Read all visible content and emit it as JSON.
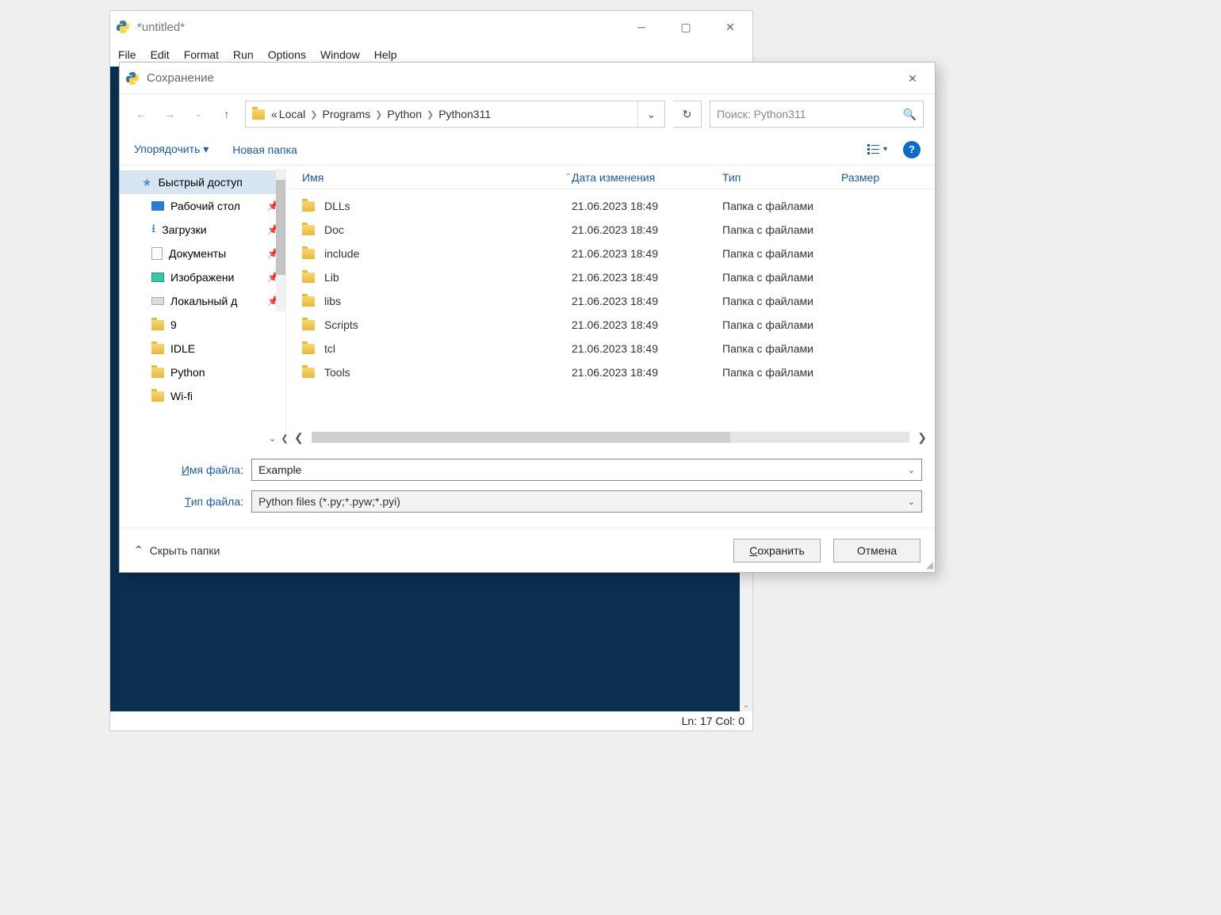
{
  "idle": {
    "title": "*untitled*",
    "menu": [
      "File",
      "Edit",
      "Format",
      "Run",
      "Options",
      "Window",
      "Help"
    ],
    "status": "Ln: 17  Col: 0"
  },
  "dialog": {
    "title": "Сохранение",
    "breadcrumb": {
      "prefix": "«",
      "parts": [
        "Local",
        "Programs",
        "Python",
        "Python311"
      ]
    },
    "search_placeholder": "Поиск: Python311",
    "toolbar": {
      "organize": "Упорядочить",
      "new_folder": "Новая папка"
    },
    "sidebar": [
      {
        "label": "Быстрый доступ",
        "icon": "star",
        "selected": true
      },
      {
        "label": "Рабочий стол",
        "icon": "desktop",
        "pin": true,
        "level": 2
      },
      {
        "label": "Загрузки",
        "icon": "download",
        "pin": true,
        "level": 2
      },
      {
        "label": "Документы",
        "icon": "doc",
        "pin": true,
        "level": 2
      },
      {
        "label": "Изображени",
        "icon": "img",
        "pin": true,
        "level": 2
      },
      {
        "label": "Локальный д",
        "icon": "disk",
        "pin": true,
        "level": 2
      },
      {
        "label": "9",
        "icon": "folder",
        "level": 2
      },
      {
        "label": "IDLE",
        "icon": "folder",
        "level": 2
      },
      {
        "label": "Python",
        "icon": "folder",
        "level": 2
      },
      {
        "label": "Wi-fi",
        "icon": "folder",
        "level": 2
      }
    ],
    "columns": {
      "name": "Имя",
      "date": "Дата изменения",
      "type": "Тип",
      "size": "Размер"
    },
    "files": [
      {
        "name": "DLLs",
        "date": "21.06.2023 18:49",
        "type": "Папка с файлами"
      },
      {
        "name": "Doc",
        "date": "21.06.2023 18:49",
        "type": "Папка с файлами"
      },
      {
        "name": "include",
        "date": "21.06.2023 18:49",
        "type": "Папка с файлами"
      },
      {
        "name": "Lib",
        "date": "21.06.2023 18:49",
        "type": "Папка с файлами"
      },
      {
        "name": "libs",
        "date": "21.06.2023 18:49",
        "type": "Папка с файлами"
      },
      {
        "name": "Scripts",
        "date": "21.06.2023 18:49",
        "type": "Папка с файлами"
      },
      {
        "name": "tcl",
        "date": "21.06.2023 18:49",
        "type": "Папка с файлами"
      },
      {
        "name": "Tools",
        "date": "21.06.2023 18:49",
        "type": "Папка с файлами"
      }
    ],
    "fields": {
      "name_label": "Имя файла:",
      "name_value": "Example",
      "type_label": "Тип файла:",
      "type_value": "Python files (*.py;*.pyw;*.pyi)"
    },
    "hide_folders": "Скрыть папки",
    "buttons": {
      "save": "Сохранить",
      "cancel": "Отмена"
    }
  }
}
